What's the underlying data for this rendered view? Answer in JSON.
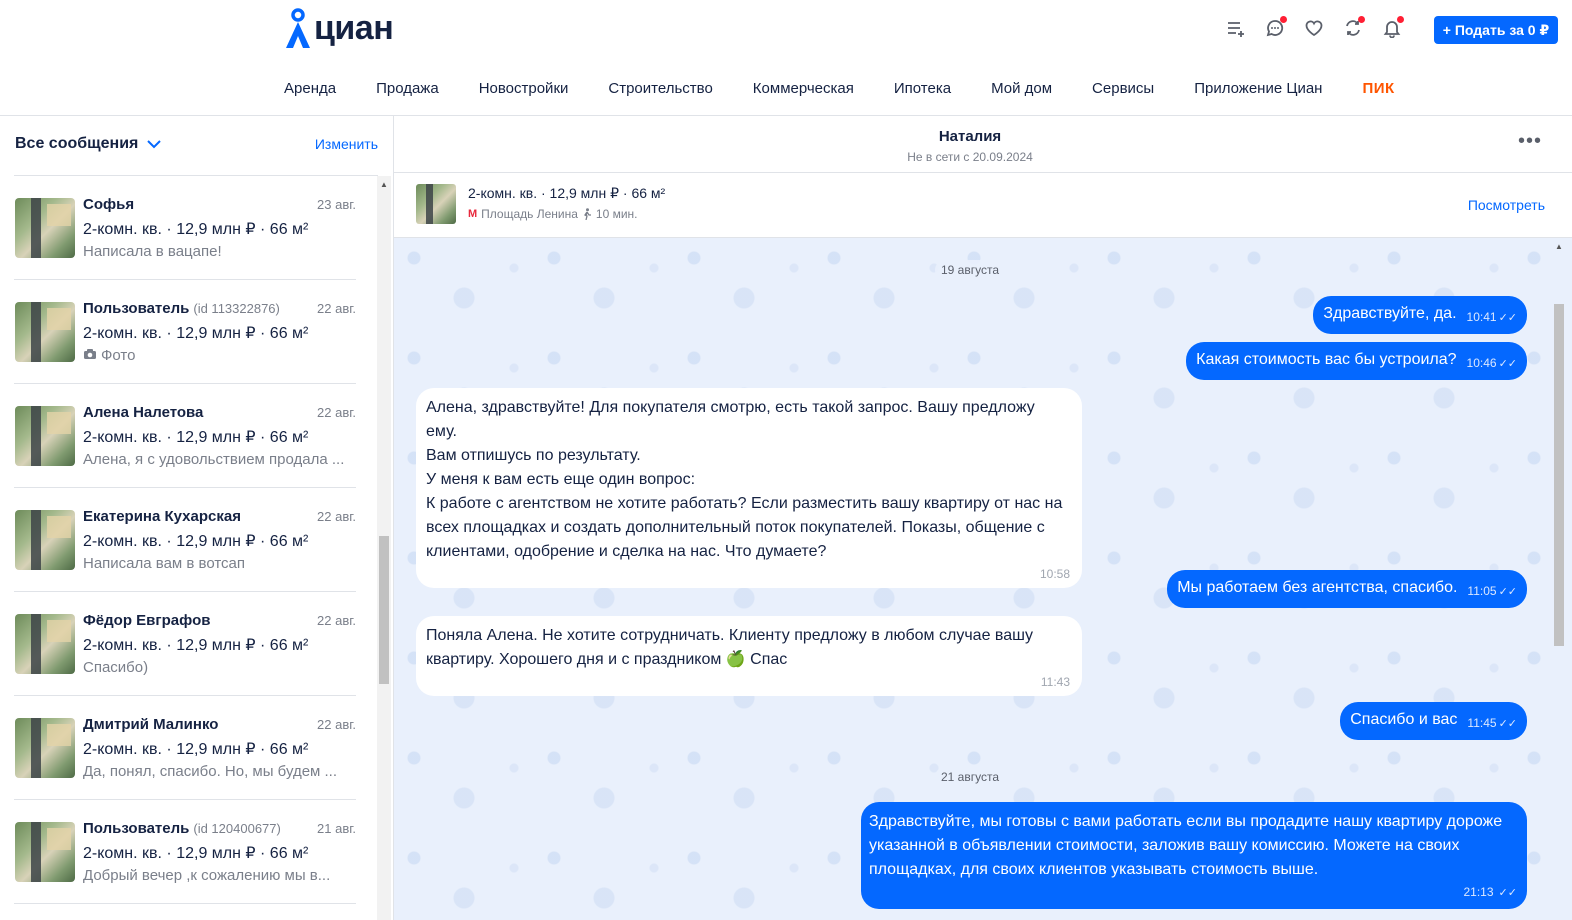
{
  "header": {
    "logo_text": "циан",
    "post_button": "+ Подать за 0 ₽",
    "nav": [
      "Аренда",
      "Продажа",
      "Новостройки",
      "Строительство",
      "Коммерческая",
      "Ипотека",
      "Мой дом",
      "Сервисы",
      "Приложение Циан",
      "ПИК"
    ],
    "icons": [
      "list-add-icon",
      "chat-icon",
      "heart-icon",
      "compare-icon",
      "bell-icon"
    ],
    "accent_color": "#0468ff",
    "badge_color": "#ff1f34",
    "pik_color": "#ff5500"
  },
  "sidebar": {
    "filter_label": "Все сообщения",
    "edit_label": "Изменить",
    "chats": [
      {
        "name": "Софья",
        "id": "",
        "date": "23 авг.",
        "offer": "2-комн. кв. · 12,9 млн ₽ · 66 м²",
        "last": "Написала в вацапе!"
      },
      {
        "name": "Пользователь",
        "id": "(id 113322876)",
        "date": "22 авг.",
        "offer": "2-комн. кв. · 12,9 млн ₽ · 66 м²",
        "last": "Фото"
      },
      {
        "name": "Алена Налетова",
        "id": "",
        "date": "22 авг.",
        "offer": "2-комн. кв. · 12,9 млн ₽ · 66 м²",
        "last": "Алена, я с удовольствием продала ..."
      },
      {
        "name": "Екатерина Кухарская",
        "id": "",
        "date": "22 авг.",
        "offer": "2-комн. кв. · 12,9 млн ₽ · 66 м²",
        "last": "Написала вам в вотсап"
      },
      {
        "name": "Фёдор Евграфов",
        "id": "",
        "date": "22 авг.",
        "offer": "2-комн. кв. · 12,9 млн ₽ · 66 м²",
        "last": "Спасибо)"
      },
      {
        "name": "Дмитрий Малинко",
        "id": "",
        "date": "22 авг.",
        "offer": "2-комн. кв. · 12,9 млн ₽ · 66 м²",
        "last": "Да, понял, спасибо. Но, мы будем ..."
      },
      {
        "name": "Пользователь",
        "id": "(id 120400677)",
        "date": "21 авг.",
        "offer": "2-комн. кв. · 12,9 млн ₽ · 66 м²",
        "last": "Добрый вечер ,к сожалению мы в..."
      }
    ]
  },
  "chat": {
    "contact_name": "Наталия",
    "status": "Не в сети с 20.09.2024",
    "offer": {
      "title": "2-комн. кв. · 12,9 млн ₽ · 66 м²",
      "metro_icon": "М",
      "metro": "Площадь Ленина",
      "walk": "10 мин.",
      "view_label": "Посмотреть"
    },
    "dates": [
      "19 августа",
      "21 августа"
    ],
    "messages": [
      {
        "dir": "out",
        "text": "Здравствуйте, да.",
        "time": "10:41"
      },
      {
        "dir": "out",
        "text": "Какая стоимость вас бы устроила?",
        "time": "10:46"
      },
      {
        "dir": "in",
        "text": "Алена, здравствуйте! Для покупателя смотрю, есть такой запрос. Вашу предложу ему.\nВам отпишусь по результату.\nУ меня к вам есть еще один вопрос:\nК работе с агентством не хотите работать? Если разместить вашу квартиру от нас на\nвсех площадках и создать дополнительный поток покупателей. Показы, общение с\nклиентами, одобрение и сделка на нас. Что думаете?",
        "time": "10:58"
      },
      {
        "dir": "out",
        "text": "Мы работаем без агентства, спасибо.",
        "time": "11:05"
      },
      {
        "dir": "in",
        "text": "Поняла Алена. Не хотите сотрудничать. Клиенту предложу в любом случае вашу\nквартиру. Хорошего дня и с праздником 🍏 Спас",
        "time": "11:43"
      },
      {
        "dir": "out",
        "text": "Спасибо и вас",
        "time": "11:45"
      },
      {
        "dir": "out",
        "text": "Здравствуйте, мы готовы с вами работать если вы продадите нашу квартиру дороже\nуказанной в объявлении стоимости, заложив вашу комиссию. Можете на своих\nплощадках, для своих клиентов указывать стоимость выше.",
        "time": "21:13"
      }
    ]
  }
}
